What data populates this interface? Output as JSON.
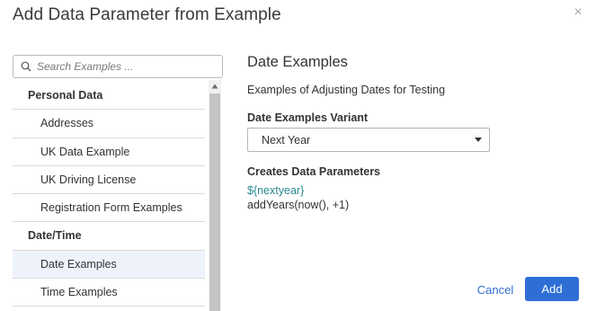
{
  "dialog": {
    "title": "Add Data Parameter from Example",
    "close_glyph": "×"
  },
  "search": {
    "placeholder": "Search Examples ...",
    "value": ""
  },
  "list": [
    {
      "kind": "group",
      "label": "Personal Data"
    },
    {
      "kind": "item",
      "label": "Addresses"
    },
    {
      "kind": "item",
      "label": "UK Data Example"
    },
    {
      "kind": "item",
      "label": "UK Driving License"
    },
    {
      "kind": "item",
      "label": "Registration Form Examples"
    },
    {
      "kind": "group",
      "label": "Date/Time"
    },
    {
      "kind": "item",
      "label": "Date Examples",
      "selected": true
    },
    {
      "kind": "item",
      "label": "Time Examples"
    }
  ],
  "detail": {
    "title": "Date Examples",
    "description": "Examples of Adjusting Dates for Testing",
    "variant_label": "Date Examples Variant",
    "variant_value": "Next Year",
    "creates_label": "Creates Data Parameters",
    "param_token": "${nextyear}",
    "param_expression": "addYears(now(), +1)"
  },
  "actions": {
    "cancel_label": "Cancel",
    "add_label": "Add"
  },
  "colors": {
    "accent": "#2f6fd5",
    "token": "#2a8a8f",
    "selected_row": "#eef3fb"
  }
}
